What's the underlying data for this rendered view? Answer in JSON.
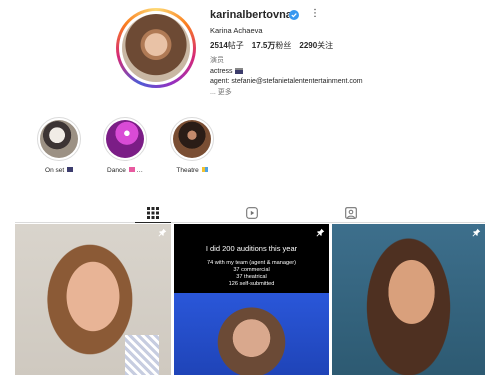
{
  "profile": {
    "username": "karinalbertovna",
    "full_name": "Karina Achaeva",
    "stats": {
      "posts_value": "2514",
      "posts_label": "帖子",
      "followers_value": "17.5万",
      "followers_label": "粉丝",
      "following_value": "2290",
      "following_label": "关注"
    },
    "bio": {
      "category": "演员",
      "line1": "actress",
      "line2": "agent: stefanie@stefanietalententertainment.com",
      "more": "... 更多"
    }
  },
  "highlights": [
    {
      "label": "On set"
    },
    {
      "label": "Dance"
    },
    {
      "label": "Theatre"
    }
  ],
  "tabs": [
    {
      "icon": "grid-icon"
    },
    {
      "icon": "reels-icon"
    },
    {
      "icon": "tagged-icon"
    }
  ],
  "posts": [
    {
      "pinned": true
    },
    {
      "pinned": true,
      "title": "I did 200 auditions this year",
      "lines": [
        "74 with my team (agent & manager)",
        "37 commercial",
        "37 theatrical",
        "126 self-submitted"
      ]
    },
    {
      "pinned": true
    }
  ],
  "colors": {
    "verified": "#3897f0",
    "text": "#262626",
    "divider": "#dbdbdb"
  }
}
